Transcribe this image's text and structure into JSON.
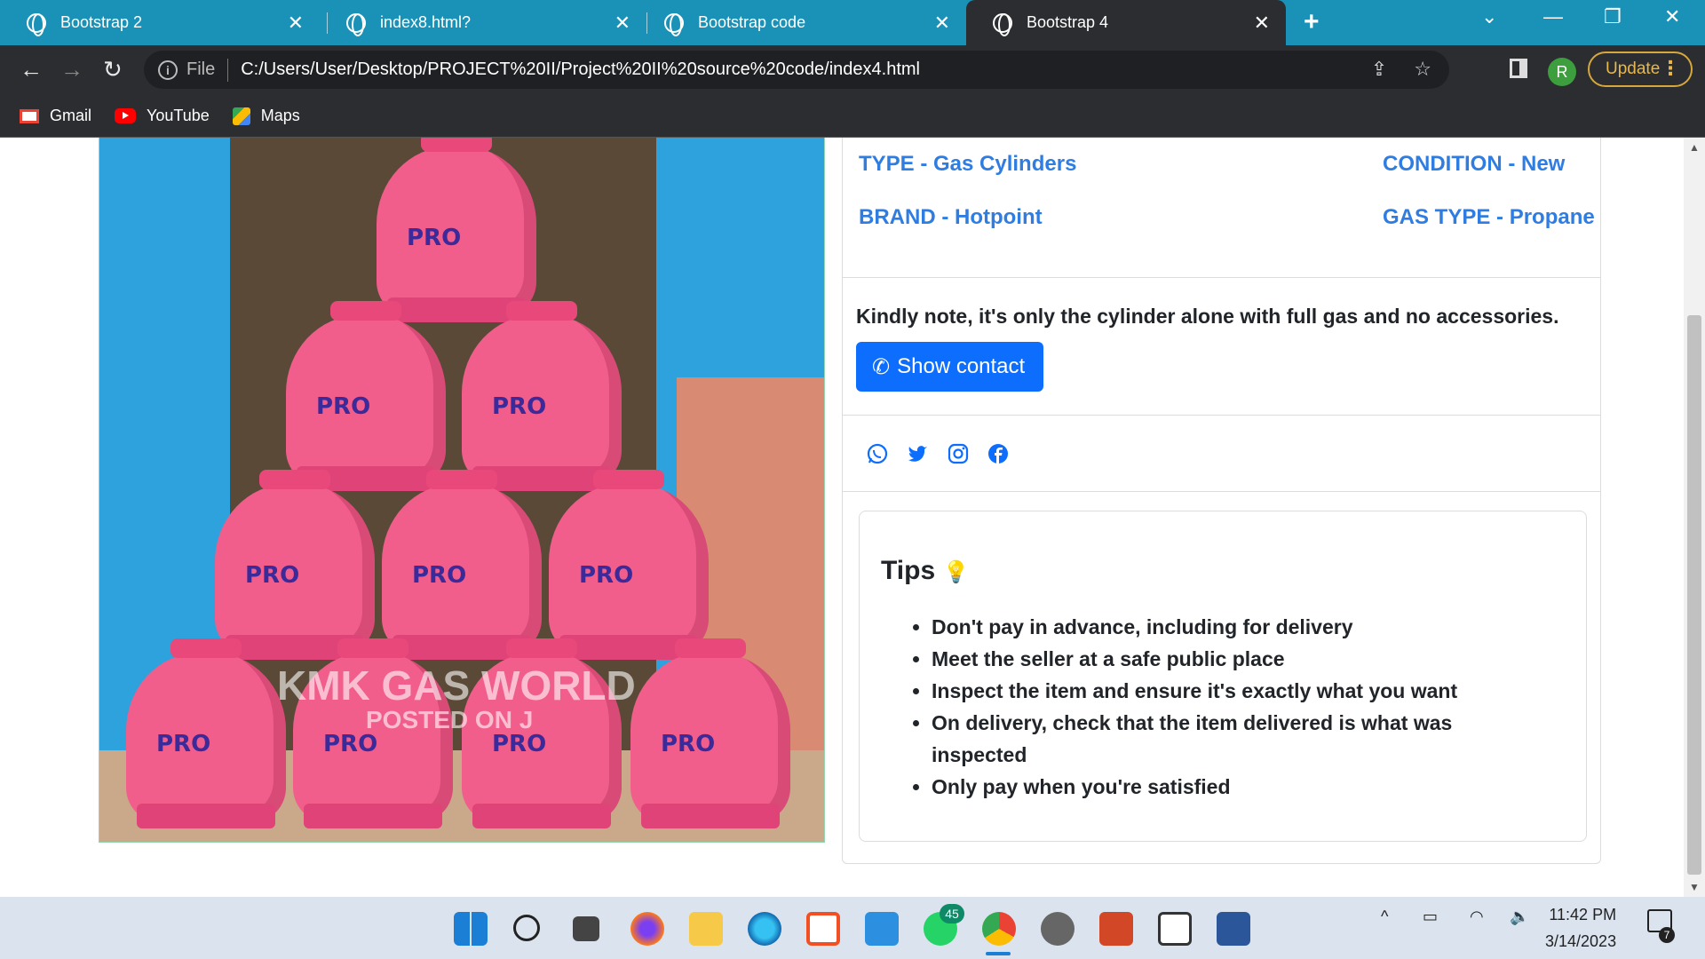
{
  "browser": {
    "tabs": [
      {
        "label": "Bootstrap 2"
      },
      {
        "label": "index8.html?"
      },
      {
        "label": "Bootstrap code"
      },
      {
        "label": "Bootstrap 4"
      }
    ],
    "address": {
      "scheme": "File",
      "url": "C:/Users/User/Desktop/PROJECT%20II/Project%20II%20source%20code/index4.html"
    },
    "profile_initial": "R",
    "update_label": "Update",
    "bookmarks": [
      {
        "label": "Gmail"
      },
      {
        "label": "YouTube"
      },
      {
        "label": "Maps"
      }
    ]
  },
  "product": {
    "image_watermark": "KMK GAS WORLD",
    "image_posted": "POSTED ON J",
    "cylinder_label": "PRO",
    "specs": {
      "type": "TYPE - Gas Cylinders",
      "condition": "CONDITION - New",
      "brand": "BRAND - Hotpoint",
      "gas_type": "GAS TYPE - Propane"
    },
    "note": "Kindly note, it's only the cylinder alone with full gas and no accessories.",
    "contact_button": "Show contact",
    "social": [
      "whatsapp-icon",
      "twitter-icon",
      "instagram-icon",
      "facebook-icon"
    ],
    "tips": {
      "title": "Tips",
      "items": [
        "Don't pay in advance, including for delivery",
        "Meet the seller at a safe public place",
        "Inspect the item and ensure it's exactly what you want",
        "On delivery, check that the item delivered is what was inspected",
        "Only pay when you're satisfied"
      ]
    }
  },
  "taskbar": {
    "whatsapp_badge": "45",
    "time": "11:42 PM",
    "date": "3/14/2023",
    "notification_count": "7"
  },
  "colors": {
    "tabbar": "#1a92b8",
    "accent": "#2f7de1",
    "button": "#0d6efd",
    "chrome": "#2b2d31"
  }
}
